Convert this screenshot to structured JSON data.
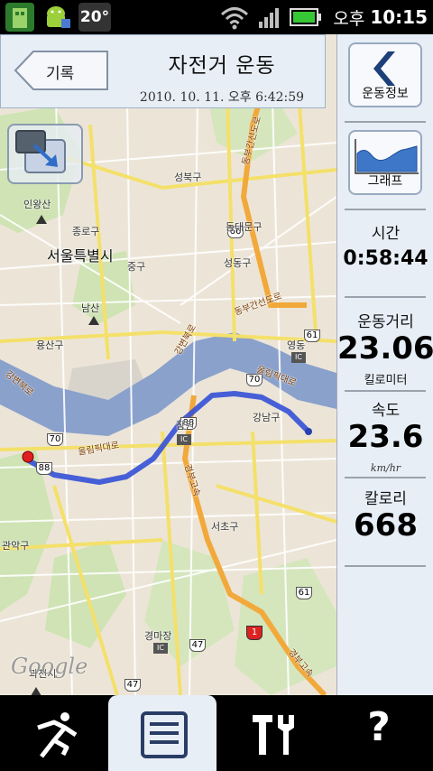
{
  "status_bar": {
    "temperature": "20°",
    "ampm": "오후",
    "time": "10:15",
    "icons": [
      "app-icon",
      "android-icon",
      "wifi-icon",
      "signal-icon",
      "battery-icon"
    ]
  },
  "header": {
    "back_label": "기록",
    "title": "자전거 운동",
    "datetime": "2010. 10. 11. 오후 6:42:59"
  },
  "map": {
    "labels": {
      "seoul": "서울특별시",
      "seongbuk": "성북구",
      "inwangsan": "인왕산",
      "jongno": "종로구",
      "dongdaemun": "동대문구",
      "jung": "중구",
      "seongdong": "성동구",
      "namsan": "남산",
      "yongsan": "용산구",
      "yeongdong": "영동",
      "gangnam": "강남구",
      "jamwon": "잠원",
      "seocho": "서초구",
      "gwanak": "관악구",
      "gyeongmajang": "경마장",
      "gwacheon": "과천시",
      "olympic1": "올림픽대로",
      "olympic2": "올림픽대로",
      "gangbyeon": "강변북로",
      "gangbyeon2": "강변북로",
      "dongbu1": "동부간선도로",
      "dongbu2": "동부간선도로",
      "gyeongbu1": "경부고속",
      "gyeongbu2": "경부고속",
      "ic1": "IC",
      "ic2": "IC",
      "ic3": "IC",
      "google": "Google"
    },
    "road_badges": [
      "66",
      "61",
      "70",
      "70",
      "88",
      "88",
      "61",
      "1",
      "47",
      "47"
    ]
  },
  "panel": {
    "info_button": "운동정보",
    "graph_button": "그래프",
    "time_label": "시간",
    "time_value": "0:58:44",
    "distance_label": "운동거리",
    "distance_value": "23.06",
    "distance_unit": "킬로미터",
    "speed_label": "속도",
    "speed_value": "23.6",
    "speed_unit": "km/hr",
    "calorie_label": "칼로리",
    "calorie_value": "668"
  },
  "bottom_nav": {
    "tabs": [
      "exercise-tab",
      "records-tab",
      "settings-tab",
      "help-tab"
    ],
    "active": "records-tab",
    "help_glyph": "?"
  },
  "colors": {
    "route": "#3550d6",
    "river": "#8aa1cc",
    "highway": "#f2a93b",
    "panel_bg": "#e7eef6"
  }
}
